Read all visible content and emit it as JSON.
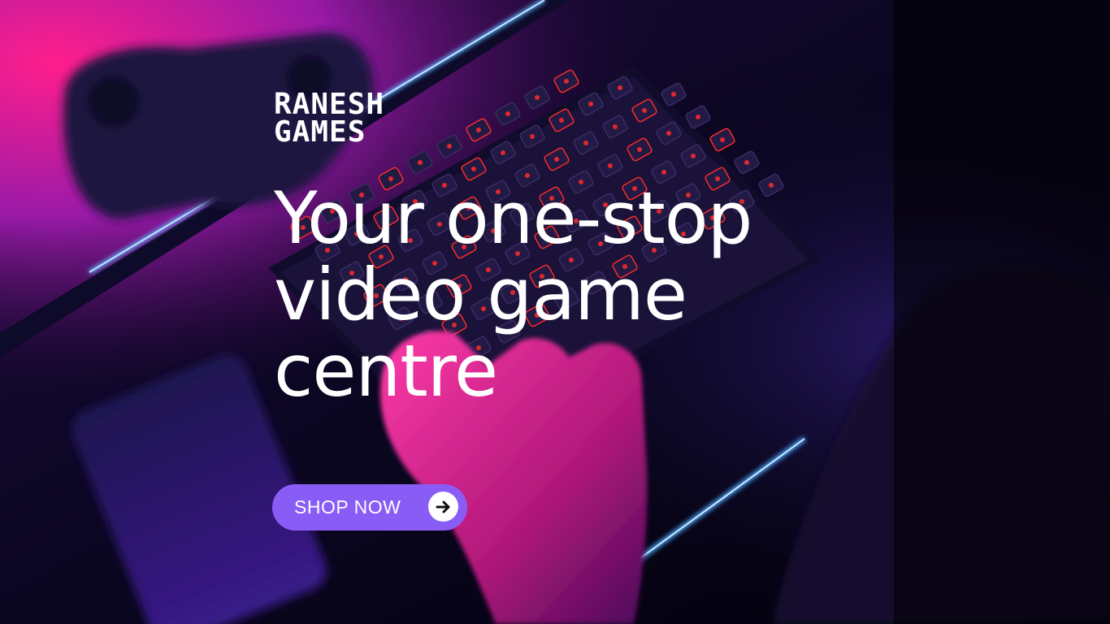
{
  "brand": {
    "line1": "RANESH",
    "line2": "GAMES"
  },
  "headline": {
    "line1": "Your one-stop",
    "line2": "video game",
    "line3": "centre"
  },
  "cta": {
    "label": "SHOP NOW",
    "icon": "arrow-right-icon"
  },
  "colors": {
    "accent": "#8a5cf6",
    "text": "#ffffff",
    "background": "#05030f",
    "neon_pink": "#ff1e8c",
    "neon_blue": "#4aa8ff",
    "key_red": "#ff2a2a"
  }
}
